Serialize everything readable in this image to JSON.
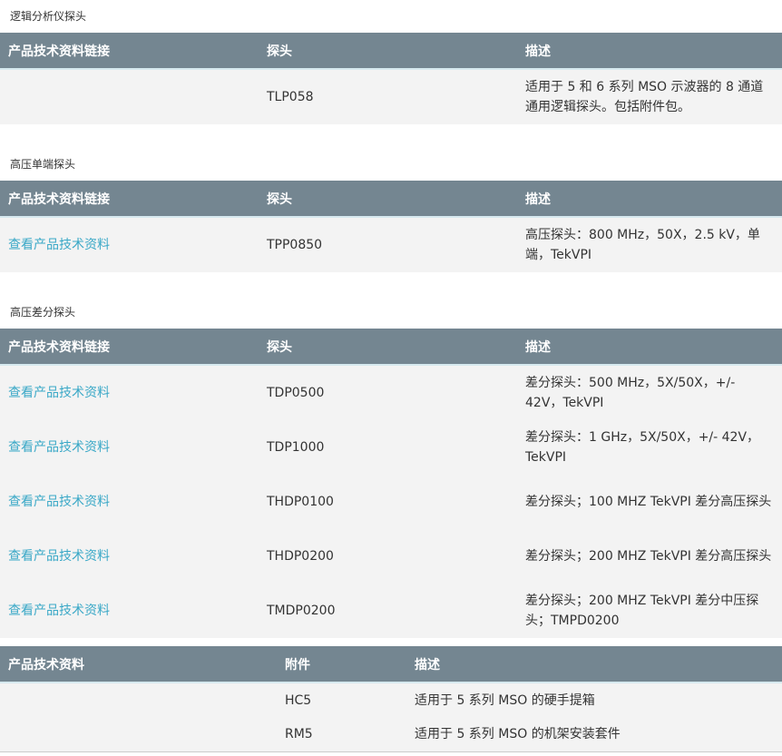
{
  "sections": [
    {
      "title": "逻辑分析仪探头",
      "headers": [
        "产品技术资料链接",
        "探头",
        "描述"
      ],
      "rows": [
        {
          "link": "",
          "probe": "TLP058",
          "desc": "适用于 5 和 6 系列 MSO 示波器的 8 通道通用逻辑探头。包括附件包。"
        }
      ]
    },
    {
      "title": "高压单端探头",
      "headers": [
        "产品技术资料链接",
        "探头",
        "描述"
      ],
      "rows": [
        {
          "link": "查看产品技术资料",
          "probe": "TPP0850",
          "desc": "高压探头：800 MHz，50X，2.5 kV，单端，TekVPI"
        }
      ]
    },
    {
      "title": "高压差分探头",
      "headers": [
        "产品技术资料链接",
        "探头",
        "描述"
      ],
      "rows": [
        {
          "link": "查看产品技术资料",
          "probe": "TDP0500",
          "desc": "差分探头：500 MHz，5X/50X，+/- 42V，TekVPI"
        },
        {
          "link": "查看产品技术资料",
          "probe": "TDP1000",
          "desc": "差分探头：1 GHz，5X/50X，+/- 42V，TekVPI"
        },
        {
          "link": "查看产品技术资料",
          "probe": "THDP0100",
          "desc": "差分探头；100 MHZ TekVPI 差分高压探头"
        },
        {
          "link": "查看产品技术资料",
          "probe": "THDP0200",
          "desc": "差分探头；200 MHZ TekVPI 差分高压探头"
        },
        {
          "link": "查看产品技术资料",
          "probe": "TMDP0200",
          "desc": "差分探头；200 MHZ TekVPI 差分中压探头；TMPD0200"
        }
      ]
    }
  ],
  "accessories": {
    "headers": [
      "产品技术资料",
      "附件",
      "描述"
    ],
    "rows": [
      {
        "link": "",
        "item": "HC5",
        "desc": "适用于 5 系列 MSO 的硬手提箱"
      },
      {
        "link": "",
        "item": "RM5",
        "desc": "适用于 5 系列 MSO 的机架安装套件"
      }
    ]
  },
  "colors": {
    "header_bg": "#748691",
    "row_bg": "#f3f3f3",
    "link": "#3aa8c7"
  }
}
